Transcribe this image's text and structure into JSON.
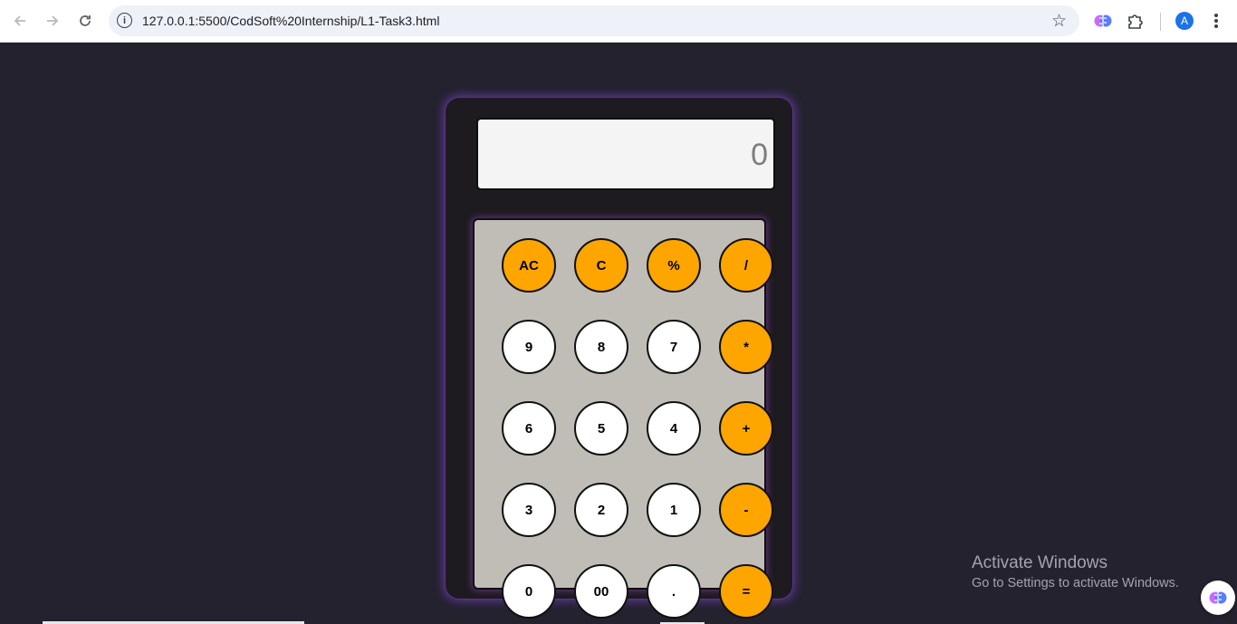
{
  "browser": {
    "url": "127.0.0.1:5500/CodSoft%20Internship/L1-Task3.html",
    "profile_initial": "A",
    "icons": [
      "back-arrow-icon",
      "forward-arrow-icon",
      "reload-icon",
      "site-info-icon",
      "bookmark-star-icon",
      "brain-extension-icon",
      "puzzle-extension-icon",
      "kebab-menu-icon"
    ]
  },
  "calculator": {
    "display_value": "0",
    "keys": [
      {
        "label": "AC",
        "type": "op",
        "name": "key-all-clear"
      },
      {
        "label": "C",
        "type": "op",
        "name": "key-clear"
      },
      {
        "label": "%",
        "type": "op",
        "name": "key-percent"
      },
      {
        "label": "/",
        "type": "op",
        "name": "key-divide"
      },
      {
        "label": "9",
        "type": "num",
        "name": "key-9"
      },
      {
        "label": "8",
        "type": "num",
        "name": "key-8"
      },
      {
        "label": "7",
        "type": "num",
        "name": "key-7"
      },
      {
        "label": "*",
        "type": "op",
        "name": "key-multiply"
      },
      {
        "label": "6",
        "type": "num",
        "name": "key-6"
      },
      {
        "label": "5",
        "type": "num",
        "name": "key-5"
      },
      {
        "label": "4",
        "type": "num",
        "name": "key-4"
      },
      {
        "label": "+",
        "type": "op",
        "name": "key-add"
      },
      {
        "label": "3",
        "type": "num",
        "name": "key-3"
      },
      {
        "label": "2",
        "type": "num",
        "name": "key-2"
      },
      {
        "label": "1",
        "type": "num",
        "name": "key-1"
      },
      {
        "label": "-",
        "type": "op",
        "name": "key-subtract"
      },
      {
        "label": "0",
        "type": "num",
        "name": "key-0"
      },
      {
        "label": "00",
        "type": "num",
        "name": "key-double-zero"
      },
      {
        "label": ".",
        "type": "num",
        "name": "key-decimal"
      },
      {
        "label": "=",
        "type": "op",
        "name": "key-equals"
      }
    ],
    "colors": {
      "operator": "#ffa500",
      "number": "#ffffff",
      "page_background": "#24222f",
      "glow": "#8c46dc"
    }
  },
  "watermark": {
    "title": "Activate Windows",
    "subtitle": "Go to Settings to activate Windows."
  }
}
